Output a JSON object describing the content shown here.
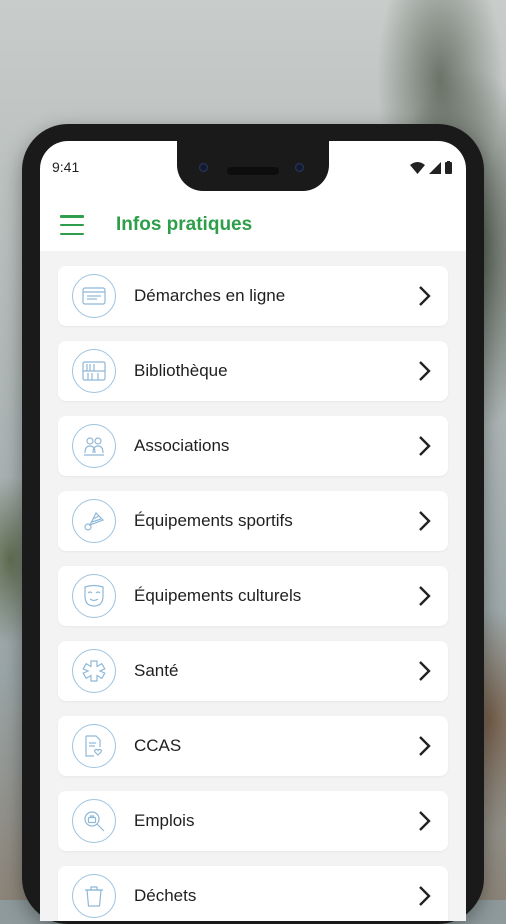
{
  "status_bar": {
    "time": "9:41"
  },
  "app_bar": {
    "title": "Infos pratiques"
  },
  "colors": {
    "accent": "#2e9e4a",
    "icon_stroke": "#8fb8d8"
  },
  "items": [
    {
      "label": "Démarches en ligne",
      "icon": "browser-window-icon"
    },
    {
      "label": "Bibliothèque",
      "icon": "bookshelf-icon"
    },
    {
      "label": "Associations",
      "icon": "people-group-icon"
    },
    {
      "label": "Équipements sportifs",
      "icon": "shuttlecock-icon"
    },
    {
      "label": "Équipements culturels",
      "icon": "theater-mask-icon"
    },
    {
      "label": "Santé",
      "icon": "medical-cross-icon"
    },
    {
      "label": "CCAS",
      "icon": "document-heart-icon"
    },
    {
      "label": "Emplois",
      "icon": "job-search-icon"
    },
    {
      "label": "Déchets",
      "icon": "trash-bin-icon"
    }
  ]
}
